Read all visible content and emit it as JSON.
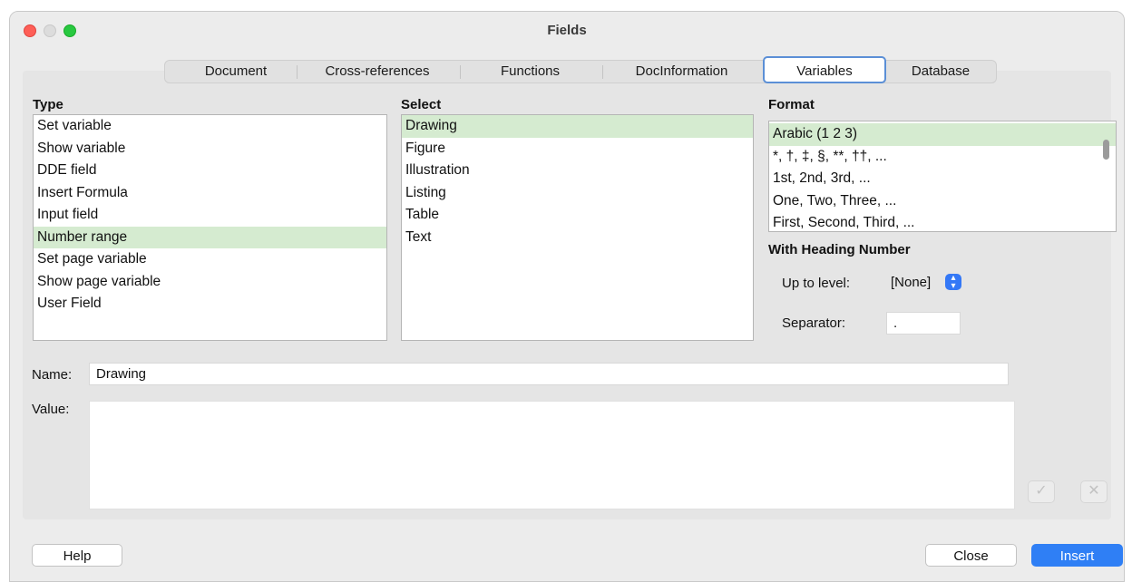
{
  "window": {
    "title": "Fields"
  },
  "tabs": [
    "Document",
    "Cross-references",
    "Functions",
    "DocInformation",
    "Variables",
    "Database"
  ],
  "active_tab": "Variables",
  "type": {
    "label": "Type",
    "items": [
      "Set variable",
      "Show variable",
      "DDE field",
      "Insert Formula",
      "Input field",
      "Number range",
      "Set page variable",
      "Show page variable",
      "User Field"
    ],
    "selected": "Number range"
  },
  "select": {
    "label": "Select",
    "items": [
      "Drawing",
      "Figure",
      "Illustration",
      "Listing",
      "Table",
      "Text"
    ],
    "selected": "Drawing"
  },
  "format": {
    "label": "Format",
    "items": [
      "Arabic (1 2 3)",
      "*, †, ‡, §, **, ††, ...",
      "1st, 2nd, 3rd, ...",
      "One, Two, Three, ...",
      "First, Second, Third, ..."
    ],
    "selected": "Arabic (1 2 3)"
  },
  "heading": {
    "label": "With Heading Number",
    "up_to_level_label": "Up to level:",
    "up_to_level_value": "[None]",
    "separator_label": "Separator:",
    "separator_value": "."
  },
  "name": {
    "label": "Name:",
    "value": "Drawing"
  },
  "value": {
    "label": "Value:",
    "value": ""
  },
  "icons": {
    "apply": "checkmark-icon",
    "delete": "x-icon"
  },
  "buttons": {
    "help": "Help",
    "close": "Close",
    "insert": "Insert"
  },
  "colors": {
    "selection": "#d5ebd0",
    "accent": "#2f7ff5",
    "tab_focus": "#5b8fd6"
  }
}
